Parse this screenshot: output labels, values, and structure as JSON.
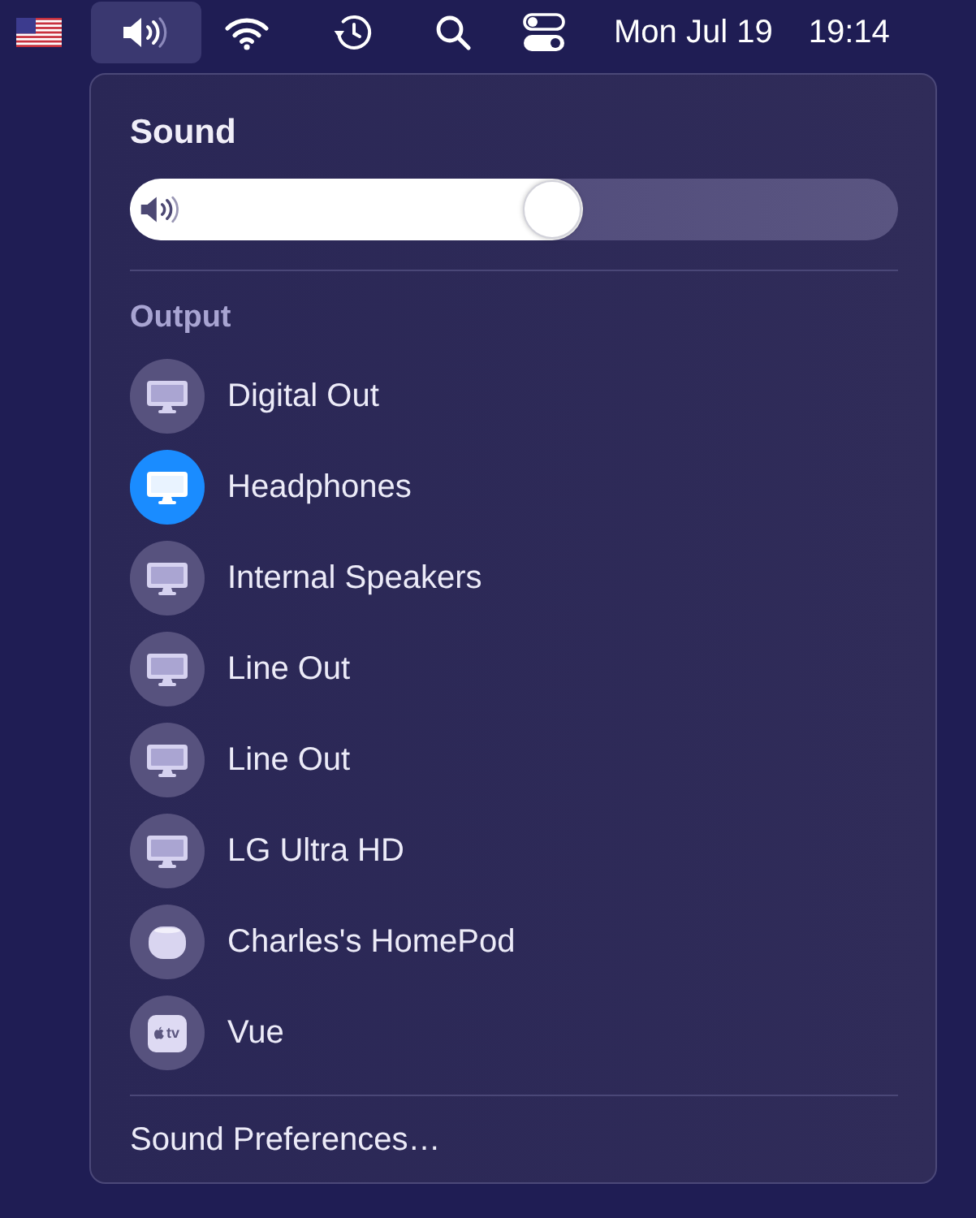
{
  "menu_bar": {
    "items": [
      {
        "kind": "flag",
        "selected": false
      },
      {
        "kind": "volume",
        "selected": true
      },
      {
        "kind": "wifi",
        "selected": false
      },
      {
        "kind": "history",
        "selected": false
      },
      {
        "kind": "search",
        "selected": false
      },
      {
        "kind": "controls",
        "selected": false
      }
    ],
    "date": "Mon Jul 19",
    "time": "19:14"
  },
  "panel": {
    "title": "Sound",
    "volume": {
      "level": 0.59
    },
    "section_label": "Output",
    "devices": [
      {
        "name": "Digital Out",
        "kind": "display",
        "selected": false
      },
      {
        "name": "Headphones",
        "kind": "display",
        "selected": true
      },
      {
        "name": "Internal Speakers",
        "kind": "display",
        "selected": false
      },
      {
        "name": "Line Out",
        "kind": "display",
        "selected": false
      },
      {
        "name": "Line Out",
        "kind": "display",
        "selected": false
      },
      {
        "name": "LG Ultra HD",
        "kind": "display",
        "selected": false
      },
      {
        "name": "Charles's HomePod",
        "kind": "speaker",
        "selected": false
      },
      {
        "name": "Vue",
        "kind": "tv",
        "selected": false,
        "icon_text": "tv"
      }
    ],
    "footer_item": "Sound Preferences…"
  }
}
